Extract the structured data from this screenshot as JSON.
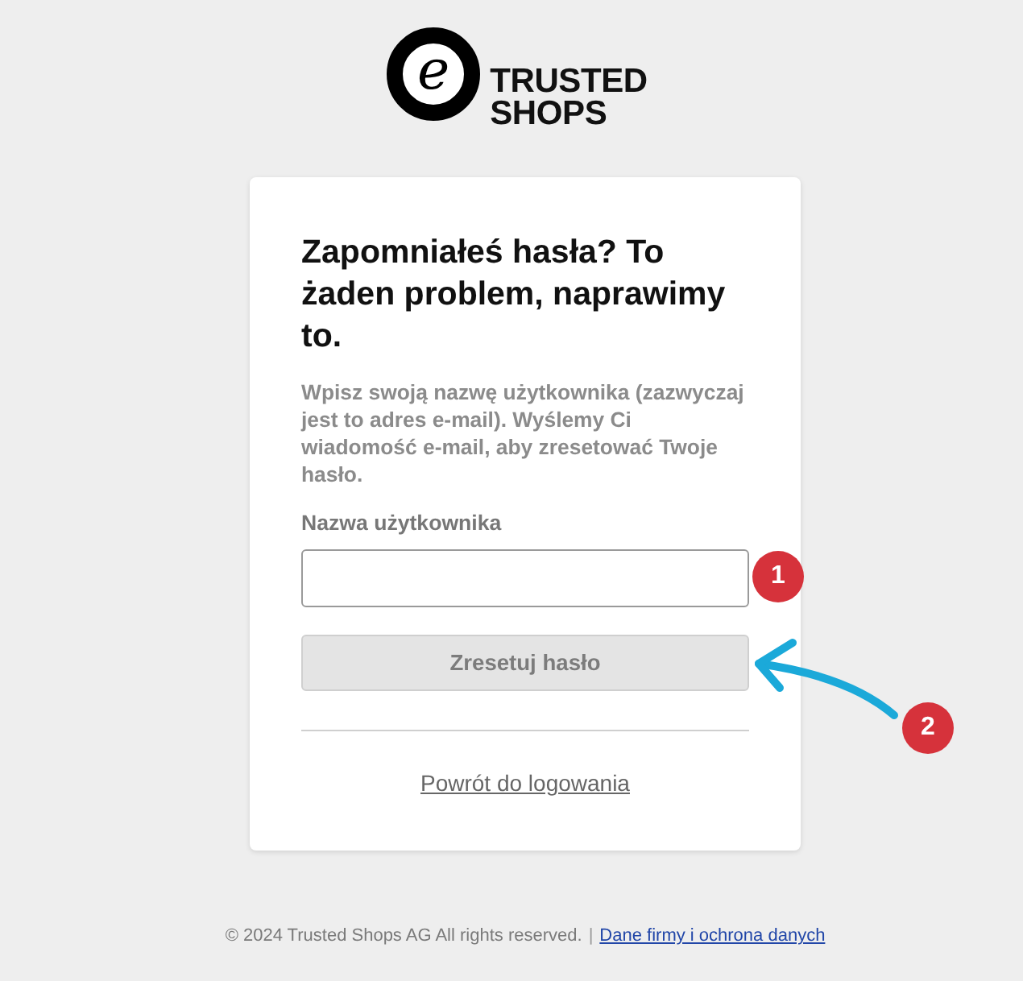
{
  "logo": {
    "emblem": "e",
    "line_1": "TRUSTED",
    "line_2": "SHOPS"
  },
  "card": {
    "title": "Zapomniałeś hasła? To żaden problem, naprawimy to.",
    "description": "Wpisz swoją nazwę użytkownika (zazwyczaj jest to adres e-mail). Wyślemy Ci wiadomość e-mail, aby zresetować Twoje hasło.",
    "username_label": "Nazwa użytkownika",
    "reset_button": {
      "label": "Zresetuj hasło",
      "disabled": true
    },
    "back_link": "Powrót do logowania"
  },
  "footer": {
    "copyright": "© 2024 Trusted Shops AG All rights reserved.",
    "separator": "|",
    "privacy_link": "Dane firmy i ochrona danych"
  },
  "annotations": [
    {
      "label": "1",
      "arrow": false
    },
    {
      "label": "2",
      "arrow": true
    }
  ]
}
